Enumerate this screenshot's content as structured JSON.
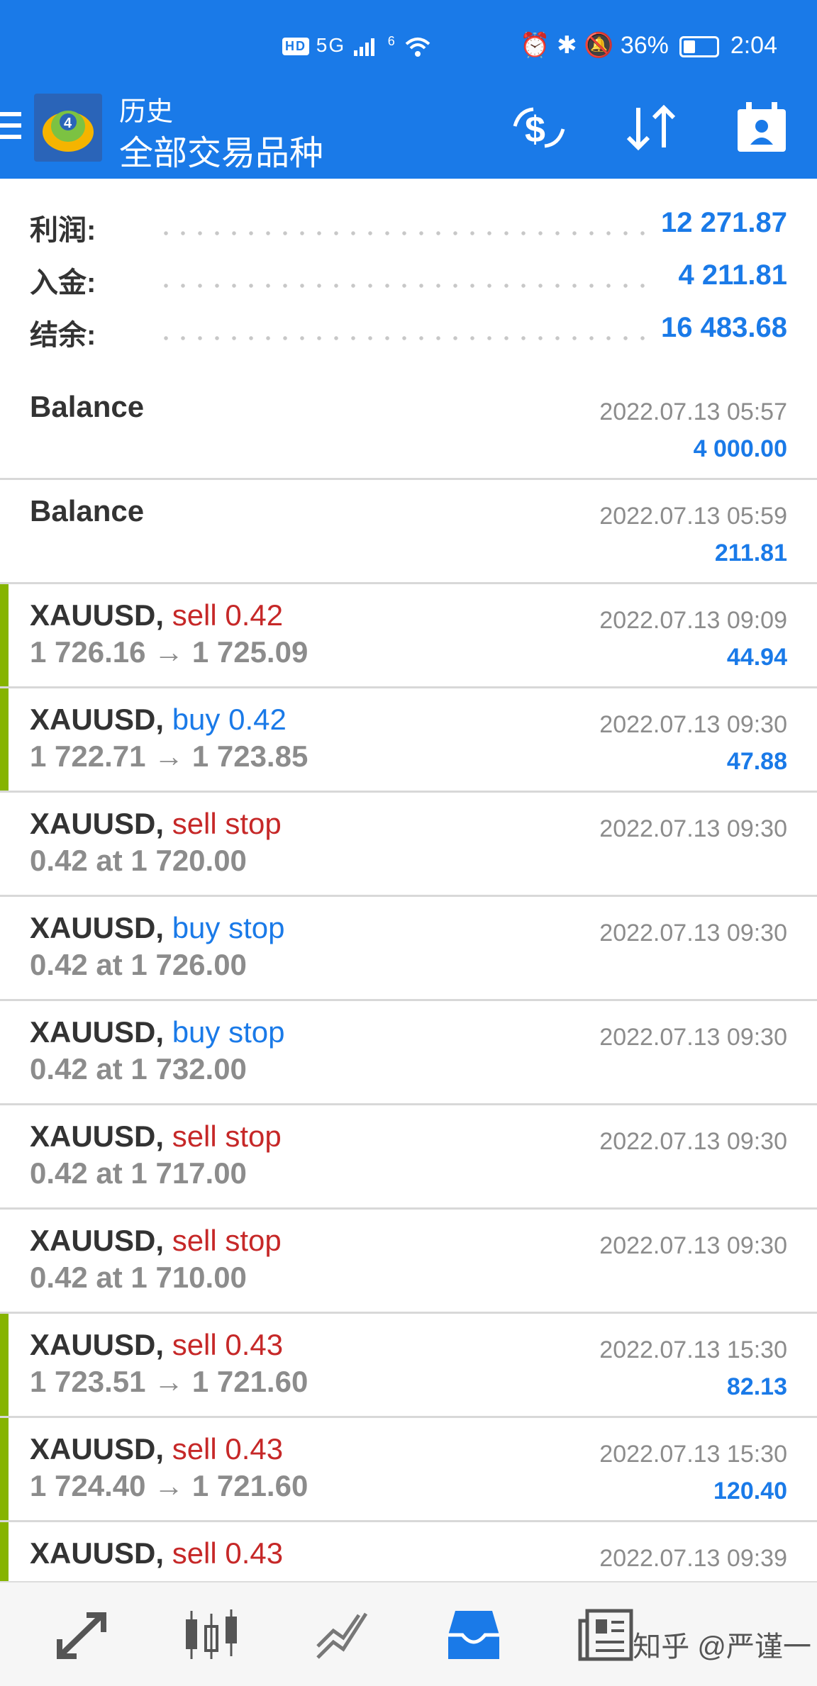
{
  "colors": {
    "accent": "#1a7ae8",
    "sell": "#c62828",
    "closed_bar": "#86b400"
  },
  "status_bar": {
    "network": "5G",
    "signal": "6",
    "battery": "36%",
    "time": "2:04"
  },
  "header": {
    "title": "历史",
    "subtitle": "全部交易品种",
    "icons": [
      "currency-exchange-icon",
      "sort-icon",
      "calendar-icon"
    ]
  },
  "summary": [
    {
      "label": "利润:",
      "value": "12 271.87"
    },
    {
      "label": "入金:",
      "value": "4 211.81"
    },
    {
      "label": "结余:",
      "value": "16 483.68"
    }
  ],
  "rows": [
    {
      "symbol": "Balance",
      "action": "",
      "action_type": "",
      "detail": "",
      "time": "2022.07.13 05:57",
      "profit": "4 000.00",
      "bar": false
    },
    {
      "symbol": "Balance",
      "action": "",
      "action_type": "",
      "detail": "",
      "time": "2022.07.13 05:59",
      "profit": "211.81",
      "bar": false
    },
    {
      "symbol": "XAUUSD,",
      "action": "sell 0.42",
      "action_type": "sell",
      "detail": "1 726.16 → 1 725.09",
      "time": "2022.07.13 09:09",
      "profit": "44.94",
      "bar": true
    },
    {
      "symbol": "XAUUSD,",
      "action": "buy 0.42",
      "action_type": "buy",
      "detail": "1 722.71 → 1 723.85",
      "time": "2022.07.13 09:30",
      "profit": "47.88",
      "bar": true
    },
    {
      "symbol": "XAUUSD,",
      "action": "sell stop",
      "action_type": "sell",
      "detail": "0.42 at 1 720.00",
      "time": "2022.07.13 09:30",
      "profit": "",
      "bar": false
    },
    {
      "symbol": "XAUUSD,",
      "action": "buy stop",
      "action_type": "buy",
      "detail": "0.42 at 1 726.00",
      "time": "2022.07.13 09:30",
      "profit": "",
      "bar": false
    },
    {
      "symbol": "XAUUSD,",
      "action": "buy stop",
      "action_type": "buy",
      "detail": "0.42 at 1 732.00",
      "time": "2022.07.13 09:30",
      "profit": "",
      "bar": false
    },
    {
      "symbol": "XAUUSD,",
      "action": "sell stop",
      "action_type": "sell",
      "detail": "0.42 at 1 717.00",
      "time": "2022.07.13 09:30",
      "profit": "",
      "bar": false
    },
    {
      "symbol": "XAUUSD,",
      "action": "sell stop",
      "action_type": "sell",
      "detail": "0.42 at 1 710.00",
      "time": "2022.07.13 09:30",
      "profit": "",
      "bar": false
    },
    {
      "symbol": "XAUUSD,",
      "action": "sell 0.43",
      "action_type": "sell",
      "detail": "1 723.51 → 1 721.60",
      "time": "2022.07.13 15:30",
      "profit": "82.13",
      "bar": true
    },
    {
      "symbol": "XAUUSD,",
      "action": "sell 0.43",
      "action_type": "sell",
      "detail": "1 724.40 → 1 721.60",
      "time": "2022.07.13 15:30",
      "profit": "120.40",
      "bar": true
    },
    {
      "symbol": "XAUUSD,",
      "action": "sell 0.43",
      "action_type": "sell",
      "detail": "",
      "time": "2022.07.13 09:39",
      "profit": "",
      "bar": true
    }
  ],
  "bottom_nav": [
    {
      "icon": "quotes-icon"
    },
    {
      "icon": "chart-icon"
    },
    {
      "icon": "trade-icon"
    },
    {
      "icon": "history-icon",
      "active": true
    },
    {
      "icon": "news-icon"
    }
  ],
  "watermark": "知乎 @严谨一"
}
